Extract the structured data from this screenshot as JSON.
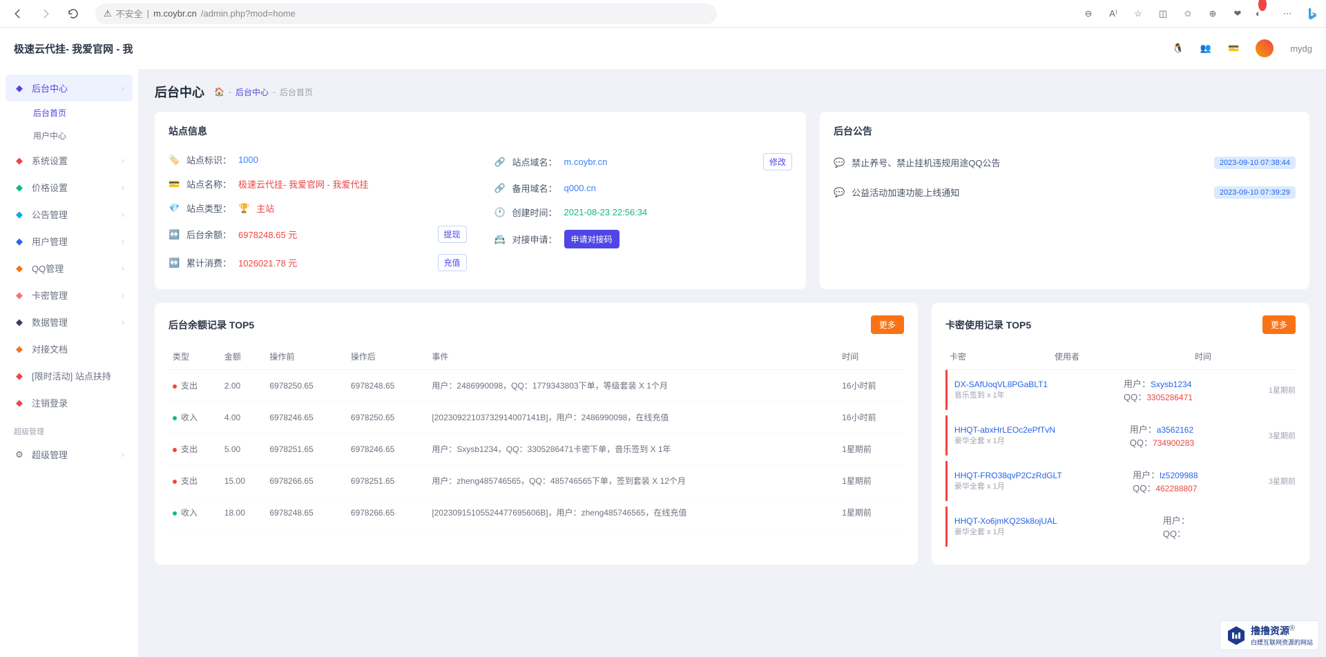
{
  "browser": {
    "insecure": "不安全",
    "host": "m.coybr.cn",
    "path": "/admin.php?mod=home"
  },
  "brand": "极速云代挂- 我爱官网 - 我",
  "user": "mydg",
  "sidebar": {
    "items": [
      {
        "icon": "dashboard-icon",
        "label": "后台中心",
        "color": "#4f46e5",
        "active": true,
        "expand": true
      },
      {
        "icon": "gear-icon",
        "label": "系统设置",
        "color": "#ef4444",
        "expand": true
      },
      {
        "icon": "cart-icon",
        "label": "价格设置",
        "color": "#10b981",
        "expand": true
      },
      {
        "icon": "megaphone-icon",
        "label": "公告管理",
        "color": "#0ea5e9",
        "expand": true
      },
      {
        "icon": "users-icon",
        "label": "用户管理",
        "color": "#2563eb",
        "expand": true
      },
      {
        "icon": "penguin-icon",
        "label": "QQ管理",
        "color": "#f97316",
        "expand": true
      },
      {
        "icon": "card-icon",
        "label": "卡密管理",
        "color": "#f87171",
        "expand": true
      },
      {
        "icon": "list-icon",
        "label": "数据管理",
        "color": "#374151",
        "expand": true
      },
      {
        "icon": "book-icon",
        "label": "对接文档",
        "color": "#f97316"
      },
      {
        "icon": "campaign-icon",
        "label": "[限时活动] 站点扶持",
        "color": "#ef4444"
      },
      {
        "icon": "logout-icon",
        "label": "注销登录",
        "color": "#ef4444"
      }
    ],
    "sub1": "后台首页",
    "sub2": "用户中心",
    "section": "超级管理",
    "super": {
      "label": "超级管理"
    }
  },
  "page": {
    "title": "后台中心",
    "crumb1": "后台中心",
    "crumb2": "后台首页"
  },
  "siteinfo": {
    "title": "站点信息",
    "rows_left": [
      {
        "icon": "🏷️",
        "label": "站点标识：",
        "value": "1000",
        "cls": "val-blue"
      },
      {
        "icon": "💳",
        "label": "站点名称：",
        "value": "极速云代挂- 我爱官网 - 我爱代挂",
        "cls": "val-red"
      },
      {
        "icon": "💎",
        "label": "站点类型：",
        "value": "主站",
        "cls": "val-red",
        "trophy": true
      },
      {
        "icon": "↔️",
        "label": "后台余额：",
        "value": "6978248.65 元",
        "cls": "val-red",
        "btn": "提现"
      },
      {
        "icon": "↔️",
        "label": "累计消费：",
        "value": "1026021.78 元",
        "cls": "val-red",
        "btn": "充值"
      }
    ],
    "rows_right": [
      {
        "icon": "🔗",
        "label": "站点域名：",
        "value": "m.coybr.cn",
        "cls": "val-blue",
        "modify": "修改"
      },
      {
        "icon": "🔗",
        "label": "备用域名：",
        "value": "q000.cn",
        "cls": "val-blue"
      },
      {
        "icon": "🕐",
        "label": "创建时间：",
        "value": "2021-08-23 22:56:34",
        "cls": "val-green"
      },
      {
        "icon": "📇",
        "label": "对接申请：",
        "btn_solid": "申请对接码"
      }
    ]
  },
  "announce": {
    "title": "后台公告",
    "items": [
      {
        "text": "禁止养号、禁止挂机违规用途QQ公告",
        "time": "2023-09-10 07:38:44",
        "cls": ""
      },
      {
        "text": "公益活动加速功能上线通知",
        "time": "2023-09-10 07:39:29",
        "cls": "g"
      }
    ]
  },
  "balance": {
    "title": "后台余额记录 TOP5",
    "more": "更多",
    "headers": [
      "类型",
      "金额",
      "操作前",
      "操作后",
      "事件",
      "时间"
    ],
    "rows": [
      {
        "type": "支出",
        "dot": "out",
        "amount": "2.00",
        "before": "6978250.65",
        "after": "6978248.65",
        "event": "用户：2486990098，QQ：1779343803下单，等级套装 X 1个月",
        "time": "16小时前"
      },
      {
        "type": "收入",
        "dot": "in",
        "amount": "4.00",
        "before": "6978246.65",
        "after": "6978250.65",
        "event": "[20230922103732914007141B]，用户：2486990098，在线充值",
        "time": "16小时前"
      },
      {
        "type": "支出",
        "dot": "out",
        "amount": "5.00",
        "before": "6978251.65",
        "after": "6978246.65",
        "event": "用户：Sxysb1234，QQ：3305286471卡密下单，音乐签到 X 1年",
        "time": "1星期前"
      },
      {
        "type": "支出",
        "dot": "out",
        "amount": "15.00",
        "before": "6978266.65",
        "after": "6978251.65",
        "event": "用户：zheng485746565，QQ：485746565下单，签到套装 X 12个月",
        "time": "1星期前"
      },
      {
        "type": "收入",
        "dot": "in",
        "amount": "18.00",
        "before": "6978248.65",
        "after": "6978266.65",
        "event": "[20230915105524477695606B]，用户：zheng485746565，在线充值",
        "time": "1星期前"
      }
    ]
  },
  "cards": {
    "title": "卡密使用记录 TOP5",
    "more": "更多",
    "headers": [
      "卡密",
      "使用者",
      "时间"
    ],
    "items": [
      {
        "code": "DX-SAfUoqVL8PGaBLT1",
        "sub": "音乐签到 x 1年",
        "ulabel": "用户：",
        "user": "Sxysb1234",
        "qlabel": "QQ：",
        "qq": "3305286471",
        "time": "1星期前"
      },
      {
        "code": "HHQT-abxHrLEOc2ePfTvN",
        "sub": "豪华全套 x 1月",
        "ulabel": "用户：",
        "user": "a3562162",
        "qlabel": "QQ：",
        "qq": "734900283",
        "time": "3星期前"
      },
      {
        "code": "HHQT-FRO38qvP2CzRdGLT",
        "sub": "豪华全套 x 1月",
        "ulabel": "用户：",
        "user": "lz5209988",
        "qlabel": "QQ：",
        "qq": "462288807",
        "time": "3星期前"
      },
      {
        "code": "HHQT-Xo6jmKQ2Sk8ojUAL",
        "sub": "豪华全套 x 1月",
        "ulabel": "用户：",
        "user": "",
        "qlabel": "QQ：",
        "qq": "",
        "time": ""
      }
    ]
  },
  "watermark": {
    "t1": "撸撸资源",
    "sup": "®",
    "t2": "白嫖互联网资源的网站"
  }
}
